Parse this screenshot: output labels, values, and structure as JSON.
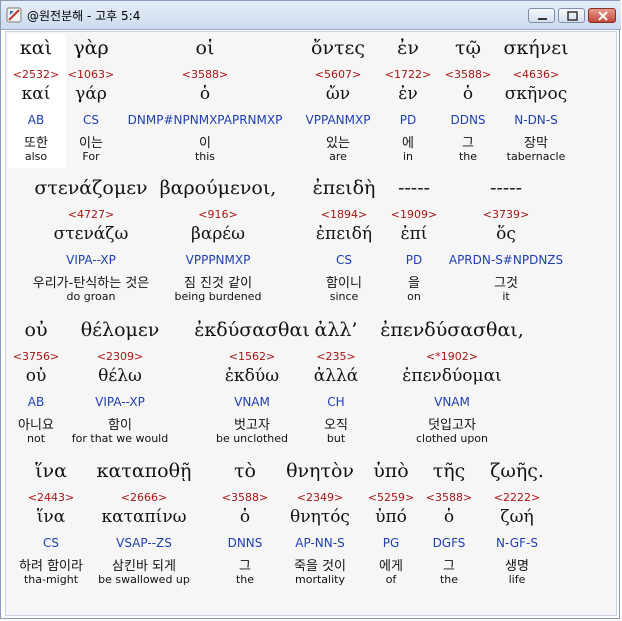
{
  "window": {
    "title": "@원전분해 - 고후 5:4"
  },
  "colors": {
    "strong": "#a81414",
    "parsing": "#1f3fb0",
    "text": "#111111"
  },
  "verse": [
    {
      "greek": "καὶ",
      "strong": "<2532>",
      "lemma": "καί",
      "parsing": "AB",
      "korean": "또한",
      "english": "also"
    },
    {
      "greek": "γὰρ",
      "strong": "<1063>",
      "lemma": "γάρ",
      "parsing": "CS",
      "korean": "이는",
      "english": "For"
    },
    {
      "greek": "οἱ",
      "strong": "<3588>",
      "lemma": "ὁ",
      "parsing": "DNMP#NPNMXPAPRNMXP",
      "korean": "이",
      "english": "this"
    },
    {
      "greek": "ὄντες",
      "strong": "<5607>",
      "lemma": "ὤν",
      "parsing": "VPPANMXP",
      "korean": "있는",
      "english": "are"
    },
    {
      "greek": "ἐν",
      "strong": "<1722>",
      "lemma": "ἐν",
      "parsing": "PD",
      "korean": "에",
      "english": "in"
    },
    {
      "greek": "τῷ",
      "strong": "<3588>",
      "lemma": "ὁ",
      "parsing": "DDNS",
      "korean": "그",
      "english": "the"
    },
    {
      "greek": "σκήνει",
      "strong": "<4636>",
      "lemma": "σκῆνος",
      "parsing": "N-DN-S",
      "korean": "장막",
      "english": "tabernacle"
    },
    {
      "greek": "στενάζομεν",
      "strong": "<4727>",
      "lemma": "στενάζω",
      "parsing": "VIPA--XP",
      "korean": "우리가-탄식하는 것은",
      "english": "do groan"
    },
    {
      "greek": "βαρούμενοι,",
      "strong": "<916>",
      "lemma": "βαρέω",
      "parsing": "VPPPNMXP",
      "korean": "짐 진것 같이",
      "english": "being burdened"
    },
    {
      "greek": "ἐπειδὴ",
      "strong": "<1894>",
      "lemma": "ἐπειδή",
      "parsing": "CS",
      "korean": "함이니",
      "english": "since"
    },
    {
      "greek": "-----",
      "strong": "<1909>",
      "lemma": "ἐπί",
      "parsing": "PD",
      "korean": "을",
      "english": "on"
    },
    {
      "greek": "-----",
      "strong": "<3739>",
      "lemma": "ὅς",
      "parsing": "APRDN-S#NPDNZS",
      "korean": "그것",
      "english": "it"
    },
    {
      "greek": "οὐ",
      "strong": "<3756>",
      "lemma": "οὐ",
      "parsing": "AB",
      "korean": "아니요",
      "english": "not"
    },
    {
      "greek": "θέλομεν",
      "strong": "<2309>",
      "lemma": "θέλω",
      "parsing": "VIPA--XP",
      "korean": "함이",
      "english": "for that we would"
    },
    {
      "greek": "ἐκδύσασθαι",
      "strong": "<1562>",
      "lemma": "ἐκδύω",
      "parsing": "VNAM",
      "korean": "벗고자",
      "english": "be unclothed"
    },
    {
      "greek": "ἀλλ’",
      "strong": "<235>",
      "lemma": "ἀλλά",
      "parsing": "CH",
      "korean": "오직",
      "english": "but"
    },
    {
      "greek": "ἐπενδύσασθαι,",
      "strong": "<*1902>",
      "lemma": "ἐπενδύομαι",
      "parsing": "VNAM",
      "korean": "덧입고자",
      "english": "clothed upon"
    },
    {
      "greek": "ἵνα",
      "strong": "<2443>",
      "lemma": "ἵνα",
      "parsing": "CS",
      "korean": "하려 함이라",
      "english": "tha-might"
    },
    {
      "greek": "καταποθῇ",
      "strong": "<2666>",
      "lemma": "καταπίνω",
      "parsing": "VSAP--ZS",
      "korean": "삼킨바 되게",
      "english": "be swallowed up"
    },
    {
      "greek": "τὸ",
      "strong": "<3588>",
      "lemma": "ὁ",
      "parsing": "DNNS",
      "korean": "그",
      "english": "the"
    },
    {
      "greek": "θνητὸν",
      "strong": "<2349>",
      "lemma": "θνητός",
      "parsing": "AP-NN-S",
      "korean": "죽을 것이",
      "english": "mortality"
    },
    {
      "greek": "ὑπὸ",
      "strong": "<5259>",
      "lemma": "ὑπό",
      "parsing": "PG",
      "korean": "에게",
      "english": "of"
    },
    {
      "greek": "τῆς",
      "strong": "<3588>",
      "lemma": "ὁ",
      "parsing": "DGFS",
      "korean": "그",
      "english": "the"
    },
    {
      "greek": "ζωῆς.",
      "strong": "<2222>",
      "lemma": "ζωή",
      "parsing": "N-GF-S",
      "korean": "생명",
      "english": "life"
    }
  ]
}
